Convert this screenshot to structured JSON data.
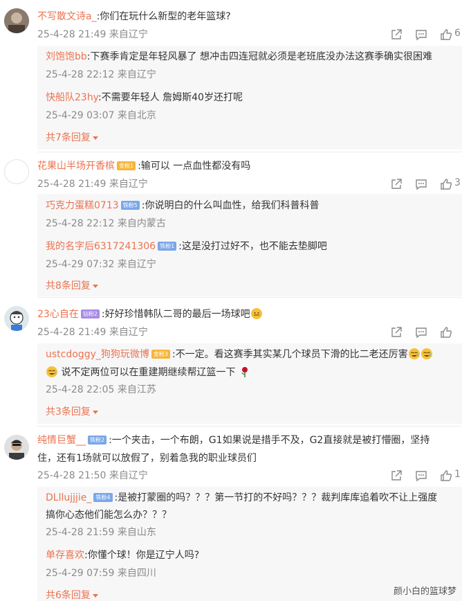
{
  "comments": [
    {
      "user": "不写散文诗a_",
      "text": ":你们在玩什么新型的老年篮球?",
      "meta": "25-4-28 21:49 来自辽宁",
      "like_count": "6",
      "replies": [
        {
          "user": "刘饱饱bb",
          "text": ":下赛季肯定是年轻风暴了 想冲击四连冠就必须是老班底没办法这赛季确实很困难",
          "meta": "25-4-28 22:12 来自辽宁"
        },
        {
          "user": "快船队23hy",
          "text": ":不需要年轻人  詹姆斯40岁还打呢",
          "meta": "25-4-29 03:07 来自北京"
        }
      ],
      "more": "共7条回复"
    },
    {
      "user": "花果山半场开香槟",
      "badge": "金粉1",
      "text": ":输可以 一点血性都没有吗",
      "meta": "25-4-28 21:49 来自辽宁",
      "like_count": "3",
      "replies": [
        {
          "user": "巧克力蛋糕0713",
          "badge": "铁粉5",
          "text": ":你说明白的什么叫血性，给我们科普科普",
          "meta": "25-4-28 22:12 来自内蒙古"
        },
        {
          "user": "我的名字后6317241306",
          "badge": "铁粉1",
          "text": ":这是没打过好不，也不能去垫脚吧",
          "meta": "25-4-29 07:32 来自辽宁"
        }
      ],
      "more": "共8条回复"
    },
    {
      "user": "23心自在",
      "badge": "钻粉2",
      "text": ":好好珍惜韩队二哥的最后一场球吧",
      "meta": "25-4-28 21:49 来自辽宁",
      "like_count": "",
      "replies": [
        {
          "user": "ustcdoggy_狗狗玩微博",
          "badge": "金粉3",
          "text": ":不一定。看这赛季其实某几个球员下滑的比二老还厉害",
          "text2": "说不定两位可以在重建期继续帮辽篮一下",
          "meta": "25-4-28 22:05 来自江苏"
        }
      ],
      "more": "共3条回复"
    },
    {
      "user": "纯情巨蟹__",
      "badge": "铁粉2",
      "text": ":一个夹击，一个布朗，G1如果说是措手不及，G2直接就是被打懵圈，坚持",
      "text2": "住，还有1场就可以放假了，别着急我的职业球员们",
      "meta": "25-4-28 21:50 来自辽宁",
      "like_count": "1",
      "replies": [
        {
          "user": "DLllujjjie_",
          "badge": "铁粉4",
          "text": ":是被打蒙圈的吗？？？第一节打的不好吗？？？裁判库库追着吹不让上强度",
          "text2": "搞你心态他们能怎么办？？？",
          "meta": "25-4-28 21:59 来自山东"
        },
        {
          "user": "单存喜欢",
          "text": ":你懂个球！你是辽宁人吗?",
          "meta": "25-4-29 07:59 来自四川"
        }
      ],
      "more": "共6条回复"
    }
  ],
  "watermark": "颜小白的篮球梦",
  "icons": [
    "share-icon",
    "comment-icon",
    "like-icon"
  ],
  "colors": {
    "username": "#eb7350",
    "meta": "#8a8a8a",
    "reply_bg": "#f7f7f7"
  }
}
